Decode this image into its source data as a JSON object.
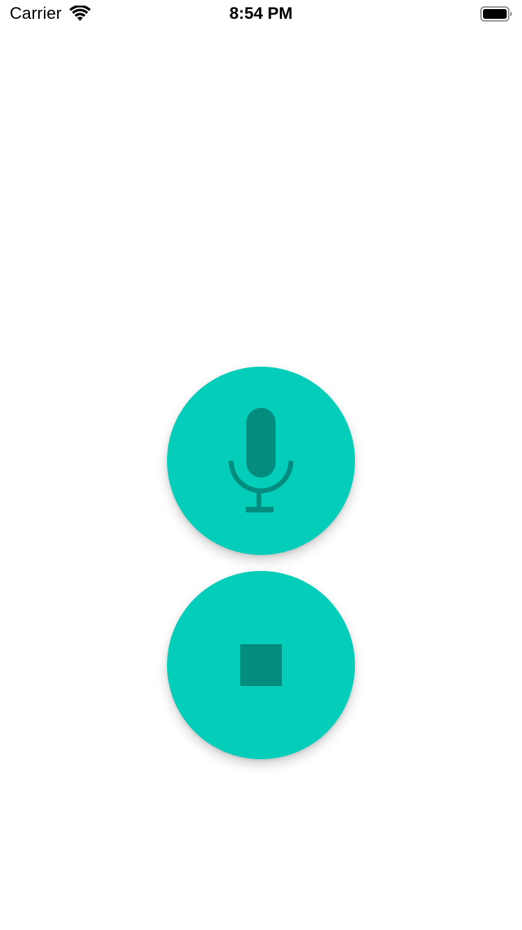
{
  "status_bar": {
    "carrier": "Carrier",
    "time": "8:54 PM",
    "icons": {
      "wifi": "wifi-icon",
      "battery": "battery-icon"
    }
  },
  "controls": {
    "record_button": {
      "icon": "microphone-icon"
    },
    "stop_button": {
      "icon": "stop-icon"
    }
  },
  "colors": {
    "button_background": "#04CEBA",
    "icon_color": "#048C7E",
    "page_background": "#FFFFFF"
  }
}
